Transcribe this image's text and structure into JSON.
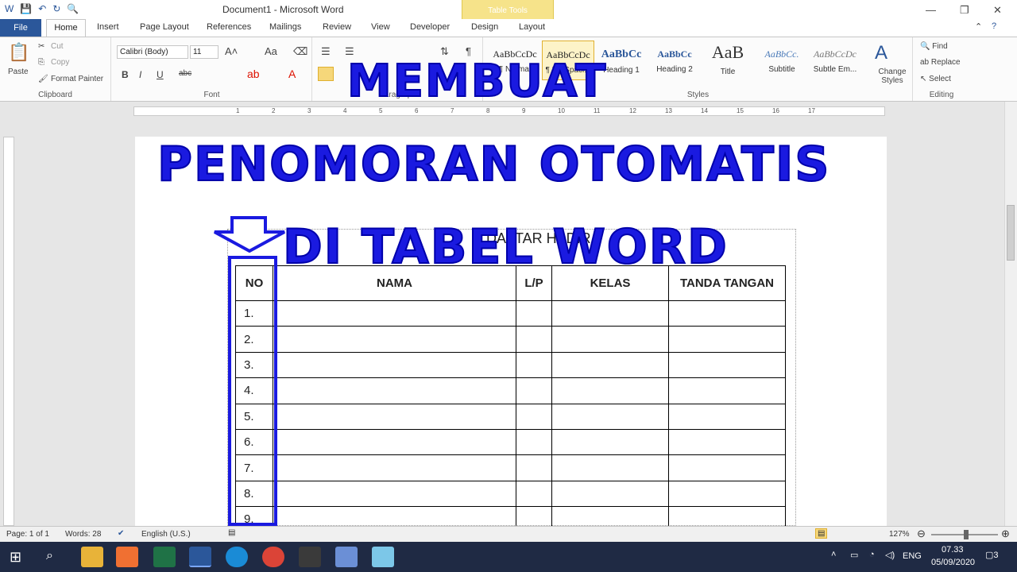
{
  "titlebar": {
    "title": "Document1 - Microsoft Word",
    "table_tools": "Table Tools"
  },
  "tabs": {
    "file": "File",
    "home": "Home",
    "insert": "Insert",
    "page_layout": "Page Layout",
    "references": "References",
    "mailings": "Mailings",
    "review": "Review",
    "view": "View",
    "developer": "Developer",
    "design": "Design",
    "layout": "Layout"
  },
  "clipboard": {
    "paste": "Paste",
    "cut": "Cut",
    "copy": "Copy",
    "format_painter": "Format Painter",
    "label": "Clipboard"
  },
  "font": {
    "name": "Calibri (Body)",
    "size": "11",
    "label": "Font",
    "bold": "B",
    "italic": "I",
    "underline": "U",
    "strike": "abc"
  },
  "paragraph": {
    "label": "Paragraph",
    "pilcrow": "¶"
  },
  "styles": {
    "label": "Styles",
    "items": [
      {
        "preview": "AaBbCcDc",
        "name": "¶ Normal"
      },
      {
        "preview": "AaBbCcDc",
        "name": "¶ No Spaci..."
      },
      {
        "preview": "AaBbCc",
        "name": "Heading 1"
      },
      {
        "preview": "AaBbCc",
        "name": "Heading 2"
      },
      {
        "preview": "AaB",
        "name": "Title"
      },
      {
        "preview": "AaBbCc.",
        "name": "Subtitle"
      },
      {
        "preview": "AaBbCcDc",
        "name": "Subtle Em..."
      }
    ],
    "change": "Change Styles"
  },
  "editing": {
    "find": "Find",
    "replace": "Replace",
    "select": "Select",
    "label": "Editing"
  },
  "ruler": {
    "ticks": [
      "1",
      "2",
      "3",
      "4",
      "5",
      "6",
      "7",
      "8",
      "9",
      "10",
      "11",
      "12",
      "13",
      "14",
      "15",
      "16",
      "17"
    ]
  },
  "document": {
    "heading": "DAFTAR HADIR",
    "headers": [
      "NO",
      "NAMA",
      "L/P",
      "KELAS",
      "TANDA TANGAN"
    ],
    "rows": [
      "1.",
      "2.",
      "3.",
      "4.",
      "5.",
      "6.",
      "7.",
      "8.",
      "9."
    ]
  },
  "overlay": {
    "line1": "MEMBUAT",
    "line2": "PENOMORAN OTOMATIS",
    "line3": "DI TABEL WORD"
  },
  "status": {
    "page": "Page: 1 of 1",
    "words": "Words: 28",
    "language": "English (U.S.)",
    "zoom": "127%"
  },
  "taskbar": {
    "lang": "ENG",
    "time": "07.33",
    "date": "05/09/2020",
    "notif": "3"
  },
  "colors": {
    "accent": "#2b579a",
    "overlay": "#1a1ae0",
    "taskbar": "#1f2a44"
  }
}
